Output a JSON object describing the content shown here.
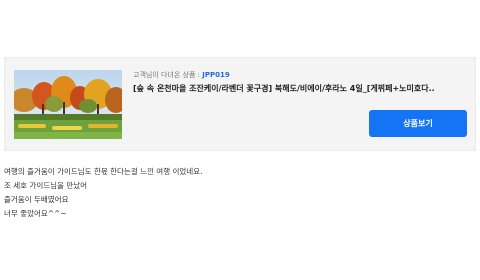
{
  "product": {
    "visited_prefix": "고객님이 다녀온 상품 : ",
    "code": "JPP019",
    "title": "[숲 속 온천마을 조잔케이/라벤더 꽃구경] 북해도/비에이/후라노 4일_[게뷔페+노미호다..",
    "image_icon": "autumn-park-photo",
    "view_button_label": "상품보기",
    "accent_color": "#1574f5"
  },
  "review": {
    "lines": [
      "여행의 즐거움이 가이드님도 한몫 한다는걸 느낀 여행 이었네요.",
      "조 세호 가이드님을 만났어",
      "즐거움이 두배였어요",
      "너무 좋았어요^^~"
    ]
  }
}
